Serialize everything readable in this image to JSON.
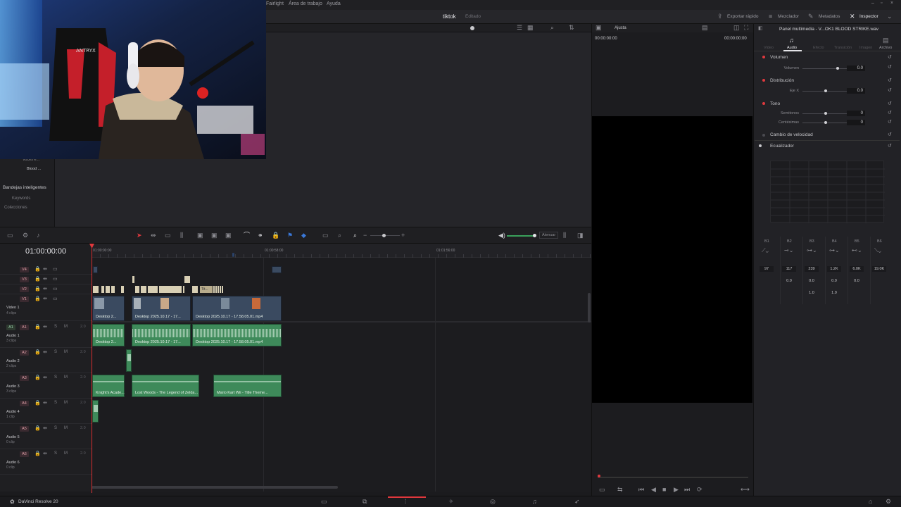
{
  "menu": {
    "fairlight": "Fairlight",
    "workspace": "Área de trabajo",
    "help": "Ayuda"
  },
  "toolbar": {
    "project_title": "tiktok",
    "project_status": "Editado",
    "quick_export": "Exportar rápido",
    "mixer": "Mezclador",
    "metadata": "Metadatos",
    "inspector": "Inspector"
  },
  "viewer": {
    "fit_label": "Ajusta",
    "timecode_left": "00:00:00:00",
    "timecode_right": "00:00:00:00"
  },
  "media_pool": {
    "folder_item": "Voces e...",
    "bin_item": "Blood ...",
    "smart_bins": "Bandejas inteligentes",
    "keywords": "Keywords",
    "collections": "Colecciones"
  },
  "inspector": {
    "panel_title": "Panel multimedia - V...OK1 BLOOD STRIKE.wav",
    "tabs": [
      "Video",
      "Audio",
      "Efecto",
      "Transición",
      "Imagen",
      "Archivo"
    ],
    "active_tab": "Audio",
    "volume": {
      "section": "Volumen",
      "label": "Volumen",
      "value": "0.0"
    },
    "distribution": {
      "section": "Distribución",
      "label": "Eje X",
      "value": "0.0"
    },
    "pitch": {
      "section": "Tono",
      "semitones_label": "Semitonos",
      "semitones_value": "0",
      "cents_label": "Centésimas",
      "cents_value": "0"
    },
    "speed_change": "Cambio de velocidad",
    "equalizer": {
      "section": "Ecualizador",
      "bands": [
        "B1",
        "B2",
        "B3",
        "B4",
        "B5",
        "B6"
      ],
      "freqs": [
        "97",
        "117",
        "239",
        "1.2K",
        "6.0K",
        "19.0K"
      ],
      "gains": [
        "",
        "0.0",
        "0.0",
        "0.0",
        "0.0",
        ""
      ],
      "qs": [
        "",
        "",
        "1.0",
        "1.0",
        "",
        ""
      ]
    }
  },
  "timeline": {
    "timecode": "01:00:00:00",
    "ruler_marks": [
      "01:00:00:00",
      "01:00:58:00",
      "01:01:56:00"
    ],
    "snap_label": "Atenuar",
    "video_tracks": [
      {
        "id": "V4"
      },
      {
        "id": "V3"
      },
      {
        "id": "V2"
      },
      {
        "id": "V1",
        "name": "Video 1",
        "clips": "4 clips"
      }
    ],
    "audio_tracks": [
      {
        "id": "A1",
        "name": "Audio 1",
        "clips": "3 clips",
        "level": "2.0"
      },
      {
        "id": "A2",
        "name": "Audio 2",
        "clips": "2 clips",
        "level": "2.0"
      },
      {
        "id": "A3",
        "name": "Audio 3",
        "clips": "3 clips",
        "level": "2.0"
      },
      {
        "id": "A4",
        "name": "Audio 4",
        "clips": "1 clip",
        "level": "2.0"
      },
      {
        "id": "A5",
        "name": "Audio 5",
        "clips": "0 clip",
        "level": "2.0"
      },
      {
        "id": "A6",
        "name": "Audio 6",
        "clips": "0 clip",
        "level": "2.0"
      }
    ],
    "v1_clips": [
      "Desktop 2...",
      "Desktop 2025.10.17 - 17...",
      "Desktop 2025.10.17 - 17.58.05.01.mp4"
    ],
    "a1_clips": [
      "Desktop 2...",
      "Desktop 2025.10.17 - 17...",
      "Desktop 2025.10.17 - 17.58.05.01.mp4"
    ],
    "a3_clips": [
      "Knight's Acade...",
      "Lost Woods - The Legend of Zelda...",
      "Mario Kart Wii - Title Theme..."
    ],
    "v2_clip_label": "Tit..."
  },
  "footer": {
    "app_name": "DaVinci Resolve 20"
  },
  "colors": {
    "video_clip": "#3a4a60",
    "audio_clip": "#3e8a5a",
    "playhead": "#e0393e",
    "accent": "#e0393e"
  }
}
